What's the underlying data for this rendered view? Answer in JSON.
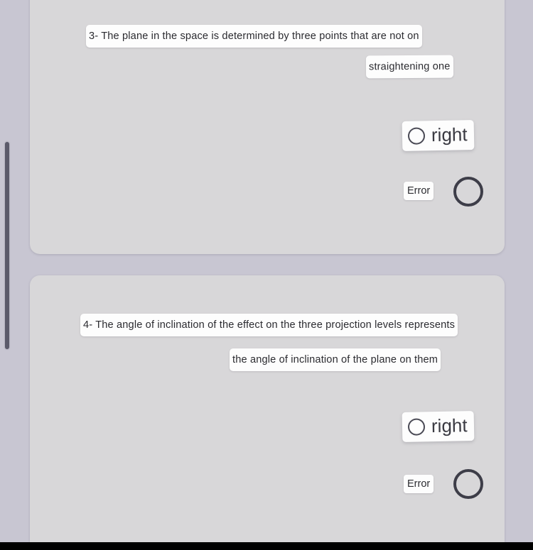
{
  "app": {
    "background_color": "#c8c6d2",
    "card_color": "#d8d7d9",
    "highlight_color": "#fdfdfd",
    "ring_color": "#3d3d48",
    "scrollbar_color": "#5b5a6a"
  },
  "scrollbar": {
    "name": "vertical-scrollbar"
  },
  "questions": [
    {
      "number": "3-",
      "text_line_1": "3- The plane in the space is determined by three points that are not on",
      "text_line_2": "straightening one",
      "options": [
        {
          "id": "right",
          "label": "right",
          "selected": false,
          "control": "radio"
        },
        {
          "id": "error",
          "label": "Error",
          "selected": false,
          "control": "radio"
        }
      ]
    },
    {
      "number": "4-",
      "text_line_1": "4- The angle of inclination of the effect on the three projection levels represents",
      "text_line_2": "the angle of inclination of the plane on them",
      "options": [
        {
          "id": "right",
          "label": "right",
          "selected": false,
          "control": "radio"
        },
        {
          "id": "error",
          "label": "Error",
          "selected": false,
          "control": "radio"
        }
      ]
    }
  ]
}
